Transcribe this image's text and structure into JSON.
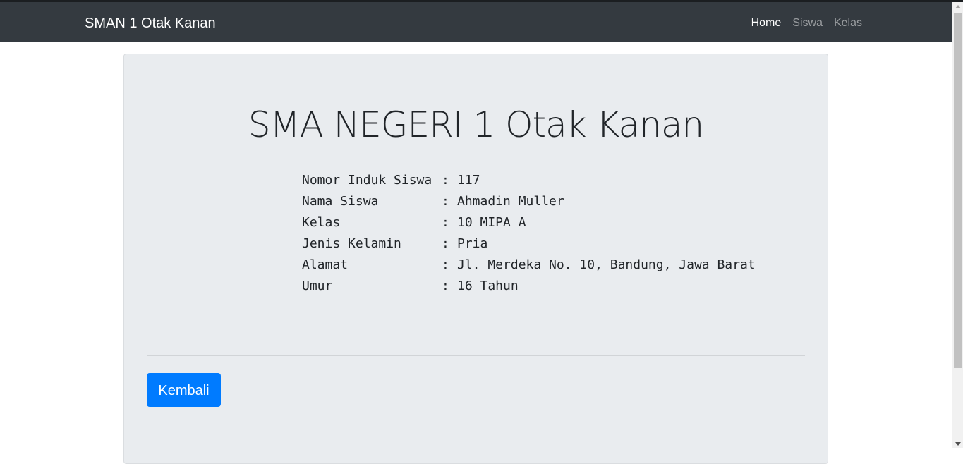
{
  "navbar": {
    "brand": "SMAN 1 Otak Kanan",
    "links": [
      {
        "label": "Home",
        "active": true
      },
      {
        "label": "Siswa",
        "active": false
      },
      {
        "label": "Kelas",
        "active": false
      }
    ]
  },
  "main": {
    "title": "SMA NEGERI 1 Otak Kanan",
    "separator": ":",
    "fields": [
      {
        "label": "Nomor Induk Siswa",
        "value": "117"
      },
      {
        "label": "Nama Siswa",
        "value": "Ahmadin Muller"
      },
      {
        "label": "Kelas",
        "value": "10 MIPA A"
      },
      {
        "label": "Jenis Kelamin",
        "value": "Pria"
      },
      {
        "label": "Alamat",
        "value": "Jl. Merdeka No. 10, Bandung, Jawa Barat"
      },
      {
        "label": "Umur",
        "value": "16 Tahun"
      }
    ],
    "back_button": "Kembali"
  },
  "colors": {
    "navbar_bg": "#343a40",
    "jumbotron_bg": "#e9ecef",
    "primary": "#007bff"
  }
}
